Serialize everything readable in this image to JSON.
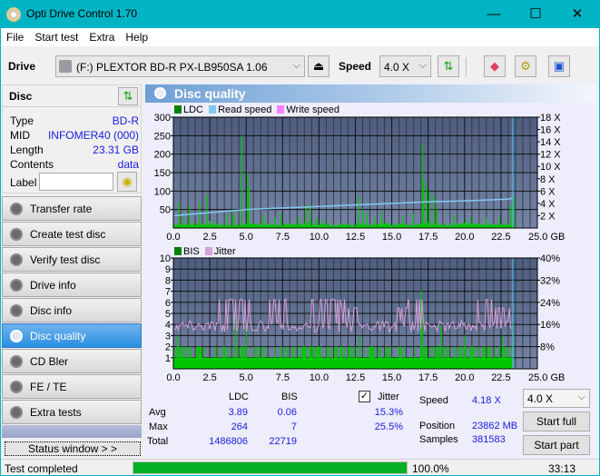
{
  "window": {
    "title": "Opti Drive Control 1.70",
    "minimize": "—",
    "maximize": "☐",
    "close": "✕"
  },
  "menu": [
    "File",
    "Start test",
    "Extra",
    "Help"
  ],
  "toolbar": {
    "drive_label": "Drive",
    "drive_value": "(F:)  PLEXTOR BD-R  PX-LB950SA 1.06",
    "speed_label": "Speed",
    "speed_value": "4.0 X"
  },
  "disc": {
    "header": "Disc",
    "fields": [
      {
        "key": "Type",
        "value": "BD-R"
      },
      {
        "key": "MID",
        "value": "INFOMER40 (000)"
      },
      {
        "key": "Length",
        "value": "23.31 GB"
      },
      {
        "key": "Contents",
        "value": "data"
      }
    ],
    "label_key": "Label",
    "label_value": ""
  },
  "nav": [
    {
      "label": "Transfer rate",
      "active": false
    },
    {
      "label": "Create test disc",
      "active": false
    },
    {
      "label": "Verify test disc",
      "active": false
    },
    {
      "label": "Drive info",
      "active": false
    },
    {
      "label": "Disc info",
      "active": false
    },
    {
      "label": "Disc quality",
      "active": true
    },
    {
      "label": "CD Bler",
      "active": false
    },
    {
      "label": "FE / TE",
      "active": false
    },
    {
      "label": "Extra tests",
      "active": false
    }
  ],
  "status_window_button": "Status window > >",
  "panel_title": "Disc quality",
  "colors": {
    "ldc": "#00c800",
    "read_speed": "#80c8f0",
    "write_speed": "#ff80ff",
    "bis": "#00c800",
    "jitter": "#d8a0d8",
    "plot_bg_top": "#4d5d80",
    "plot_bg_bottom": "#7585a8"
  },
  "chart_data": [
    {
      "type": "bar",
      "title": "LDC / Read speed",
      "legend": [
        "LDC",
        "Read speed",
        "Write speed"
      ],
      "xlabel": "GB",
      "x_ticks": [
        "0.0",
        "2.5",
        "5.0",
        "7.5",
        "10.0",
        "12.5",
        "15.0",
        "17.5",
        "20.0",
        "22.5",
        "25.0 GB"
      ],
      "xlim": [
        0,
        25
      ],
      "y_left_ticks": [
        "300",
        "250",
        "200",
        "150",
        "100",
        "50"
      ],
      "ylim_left": [
        0,
        300
      ],
      "y_right_ticks": [
        "18 X",
        "16 X",
        "14 X",
        "12 X",
        "10 X",
        "8 X",
        "6 X",
        "4 X",
        "2 X"
      ],
      "ylim_right": [
        0,
        18
      ],
      "ldc_spikes": [
        [
          0.4,
          70
        ],
        [
          1.1,
          60
        ],
        [
          1.8,
          72
        ],
        [
          2.3,
          92
        ],
        [
          3.7,
          40
        ],
        [
          4.1,
          50
        ],
        [
          4.7,
          250
        ],
        [
          5.1,
          150
        ],
        [
          5.2,
          110
        ],
        [
          6.2,
          25
        ],
        [
          7.0,
          28
        ],
        [
          7.4,
          40
        ],
        [
          8.6,
          30
        ],
        [
          9.1,
          60
        ],
        [
          9.4,
          65
        ],
        [
          11.7,
          10
        ],
        [
          12.7,
          90
        ],
        [
          13.0,
          50
        ],
        [
          13.3,
          40
        ],
        [
          14.3,
          45
        ],
        [
          16.5,
          40
        ],
        [
          17.1,
          230
        ],
        [
          17.2,
          130
        ],
        [
          17.4,
          110
        ],
        [
          17.6,
          100
        ],
        [
          17.9,
          90
        ],
        [
          18.1,
          50
        ],
        [
          19.3,
          35
        ],
        [
          20.4,
          30
        ],
        [
          22.4,
          30
        ],
        [
          23.2,
          60
        ],
        [
          23.4,
          80
        ]
      ],
      "ldc_baseline": 10,
      "read_speed": [
        [
          0,
          2.0
        ],
        [
          1,
          2.2
        ],
        [
          2,
          2.4
        ],
        [
          3,
          2.6
        ],
        [
          4,
          2.8
        ],
        [
          5,
          3.0
        ],
        [
          6,
          3.1
        ],
        [
          7,
          3.2
        ],
        [
          8,
          3.3
        ],
        [
          9,
          3.4
        ],
        [
          10,
          3.5
        ],
        [
          11,
          3.6
        ],
        [
          12,
          3.7
        ],
        [
          13,
          3.8
        ],
        [
          14,
          3.9
        ],
        [
          15,
          4.0
        ],
        [
          16,
          4.1
        ],
        [
          17,
          4.2
        ],
        [
          18,
          4.3
        ],
        [
          19,
          4.35
        ],
        [
          20,
          4.4
        ],
        [
          21,
          4.5
        ],
        [
          22,
          4.6
        ],
        [
          23,
          4.7
        ],
        [
          23.3,
          4.8
        ]
      ],
      "end_marker_gb": 23.31
    },
    {
      "type": "bar",
      "title": "BIS / Jitter",
      "legend": [
        "BIS",
        "Jitter"
      ],
      "xlabel": "GB",
      "x_ticks": [
        "0.0",
        "2.5",
        "5.0",
        "7.5",
        "10.0",
        "12.5",
        "15.0",
        "17.5",
        "20.0",
        "22.5",
        "25.0 GB"
      ],
      "xlim": [
        0,
        25
      ],
      "y_left_ticks": [
        "10",
        "9",
        "8",
        "7",
        "6",
        "5",
        "4",
        "3",
        "2",
        "1"
      ],
      "ylim_left": [
        0,
        10
      ],
      "y_right_ticks": [
        "40%",
        "32%",
        "24%",
        "16%",
        "8%"
      ],
      "ylim_right": [
        0,
        40
      ],
      "bis_baseline": 1,
      "bis_spikes": [
        [
          0.3,
          3
        ],
        [
          4.3,
          5
        ],
        [
          5.0,
          4
        ],
        [
          8.2,
          2
        ],
        [
          12.4,
          2
        ],
        [
          12.8,
          3
        ],
        [
          15.5,
          2
        ],
        [
          17.0,
          7
        ],
        [
          17.1,
          5
        ],
        [
          18.4,
          4
        ],
        [
          20.0,
          3
        ],
        [
          22.6,
          3
        ],
        [
          23.3,
          4
        ]
      ],
      "jitter_avg": 15.3,
      "jitter_peaks": [
        [
          3.5,
          25
        ],
        [
          4.2,
          25
        ],
        [
          5.0,
          25
        ],
        [
          7.2,
          25
        ],
        [
          10.0,
          25
        ],
        [
          10.5,
          25
        ],
        [
          11.2,
          25
        ],
        [
          12.0,
          22
        ],
        [
          15.5,
          22
        ],
        [
          16.5,
          25
        ],
        [
          21.3,
          25
        ],
        [
          22.0,
          25
        ],
        [
          22.5,
          22
        ]
      ],
      "end_marker_gb": 23.31
    }
  ],
  "stats": {
    "col_ldc": "LDC",
    "col_bis": "BIS",
    "jitter_label": "Jitter",
    "jitter_checked": true,
    "rows": [
      {
        "label": "Avg",
        "ldc": "3.89",
        "bis": "0.06",
        "jitter": "15.3%"
      },
      {
        "label": "Max",
        "ldc": "264",
        "bis": "7",
        "jitter": "25.5%"
      },
      {
        "label": "Total",
        "ldc": "1486806",
        "bis": "22719",
        "jitter": ""
      }
    ],
    "speed_label": "Speed",
    "speed_value": "4.18 X",
    "position_label": "Position",
    "position_value": "23862 MB",
    "samples_label": "Samples",
    "samples_value": "381583",
    "speed_select": "4.0 X",
    "start_full": "Start full",
    "start_part": "Start part"
  },
  "statusbar": {
    "text": "Test completed",
    "progress": 100.0,
    "progress_text": "100.0%",
    "time": "33:13"
  }
}
